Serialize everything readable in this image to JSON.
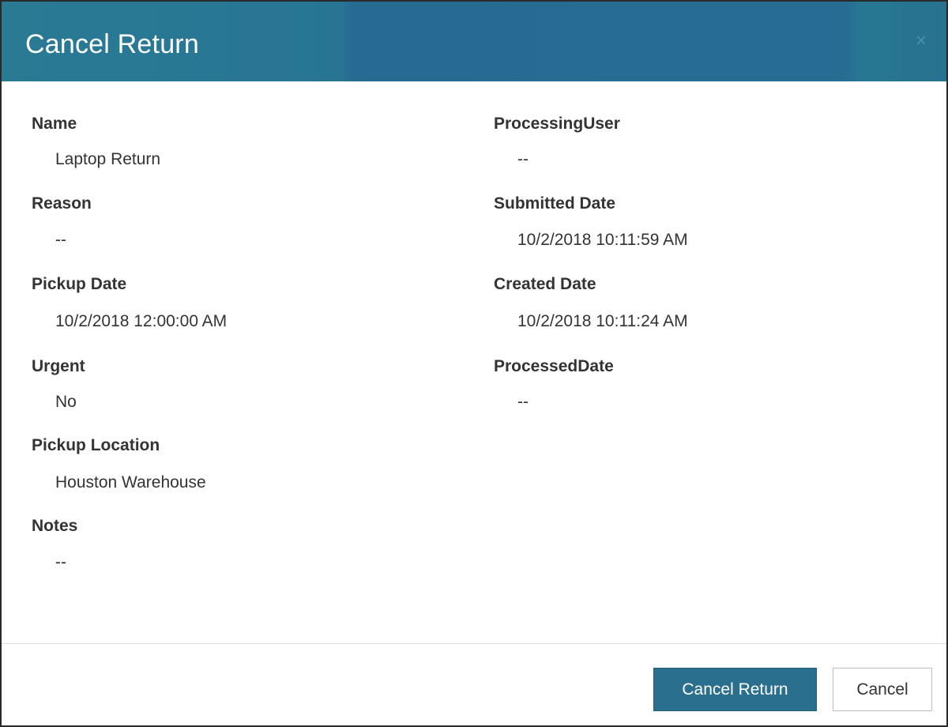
{
  "dialog": {
    "title": "Cancel Return",
    "close_icon": "×"
  },
  "left_fields": [
    {
      "label": "Name",
      "value": "Laptop Return"
    },
    {
      "label": "Reason",
      "value": "--"
    },
    {
      "label": "Pickup Date",
      "value": "10/2/2018 12:00:00 AM"
    },
    {
      "label": "Urgent",
      "value": "No"
    },
    {
      "label": "Pickup Location",
      "value": "Houston Warehouse"
    },
    {
      "label": "Notes",
      "value": "--"
    }
  ],
  "right_fields": [
    {
      "label": "ProcessingUser",
      "value": "--"
    },
    {
      "label": "Submitted Date",
      "value": "10/2/2018 10:11:59 AM"
    },
    {
      "label": "Created Date",
      "value": "10/2/2018 10:11:24 AM"
    },
    {
      "label": "ProcessedDate",
      "value": "--"
    }
  ],
  "footer": {
    "primary_label": "Cancel Return",
    "secondary_label": "Cancel"
  },
  "colors": {
    "header": "#276c93",
    "primary_button": "#2a6f8e"
  }
}
